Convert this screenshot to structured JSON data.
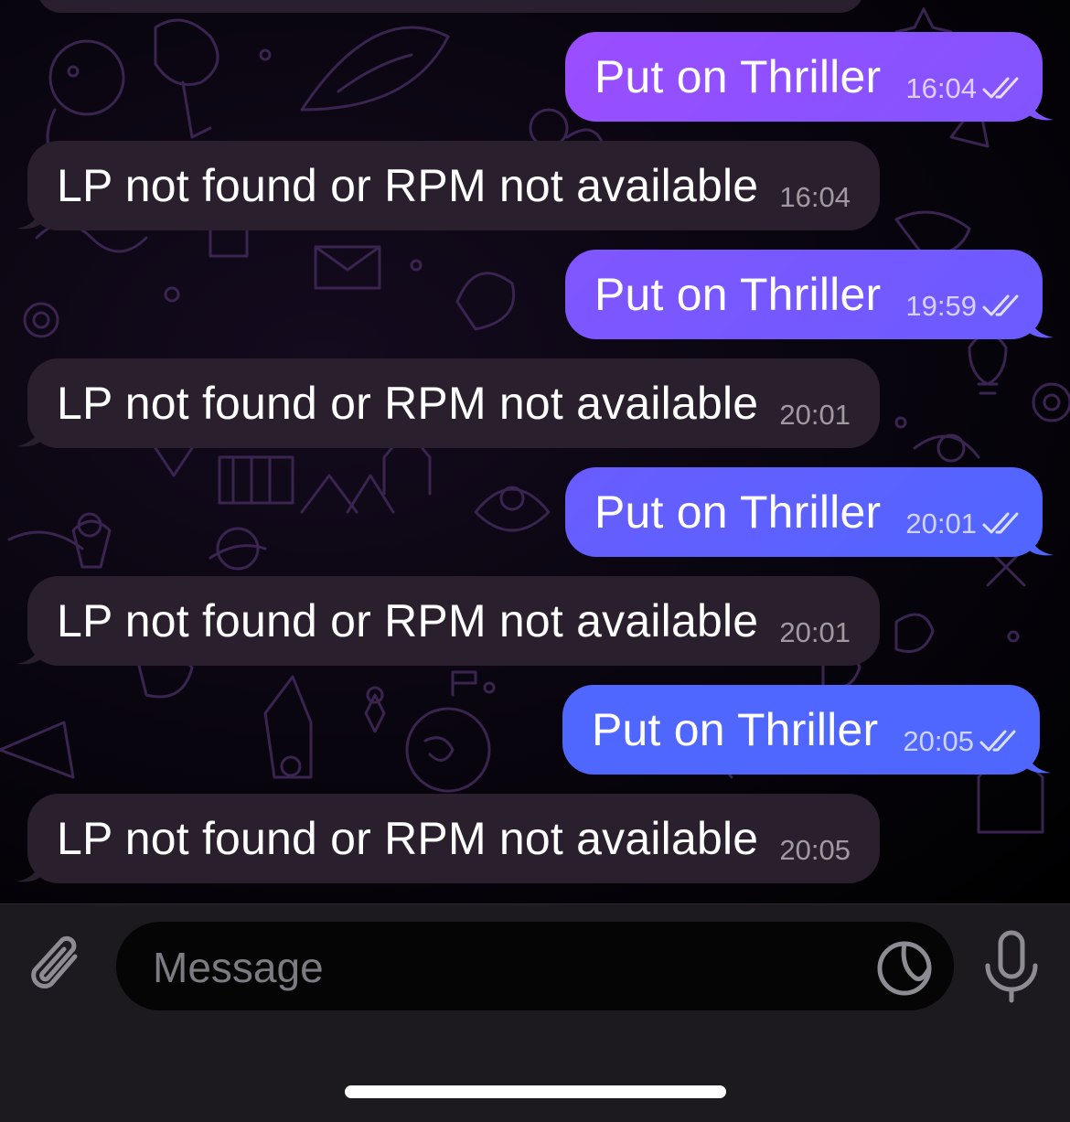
{
  "colors": {
    "incoming_bubble": "#2a1f2c",
    "outgoing_gradient": [
      "#9b4dff",
      "#8155ff",
      "#6a5cff",
      "#4f66ff"
    ],
    "composer_bg": "#1c1a1f",
    "field_bg": "#050505",
    "placeholder": "#7d7b82"
  },
  "messages": [
    {
      "direction": "out",
      "text": "Put on Thriller",
      "time": "16:04",
      "status": "read"
    },
    {
      "direction": "in",
      "text": "LP not found or RPM not available",
      "time": "16:04"
    },
    {
      "direction": "out",
      "text": "Put on Thriller",
      "time": "19:59",
      "status": "read"
    },
    {
      "direction": "in",
      "text": "LP not found or RPM not available",
      "time": "20:01"
    },
    {
      "direction": "out",
      "text": "Put on Thriller",
      "time": "20:01",
      "status": "read"
    },
    {
      "direction": "in",
      "text": "LP not found or RPM not available",
      "time": "20:01"
    },
    {
      "direction": "out",
      "text": "Put on Thriller",
      "time": "20:05",
      "status": "read"
    },
    {
      "direction": "in",
      "text": "LP not found or RPM not available",
      "time": "20:05"
    }
  ],
  "composer": {
    "placeholder": "Message",
    "value": "",
    "attach_icon": "paperclip-icon",
    "sticker_icon": "sticker-icon",
    "mic_icon": "microphone-icon"
  }
}
